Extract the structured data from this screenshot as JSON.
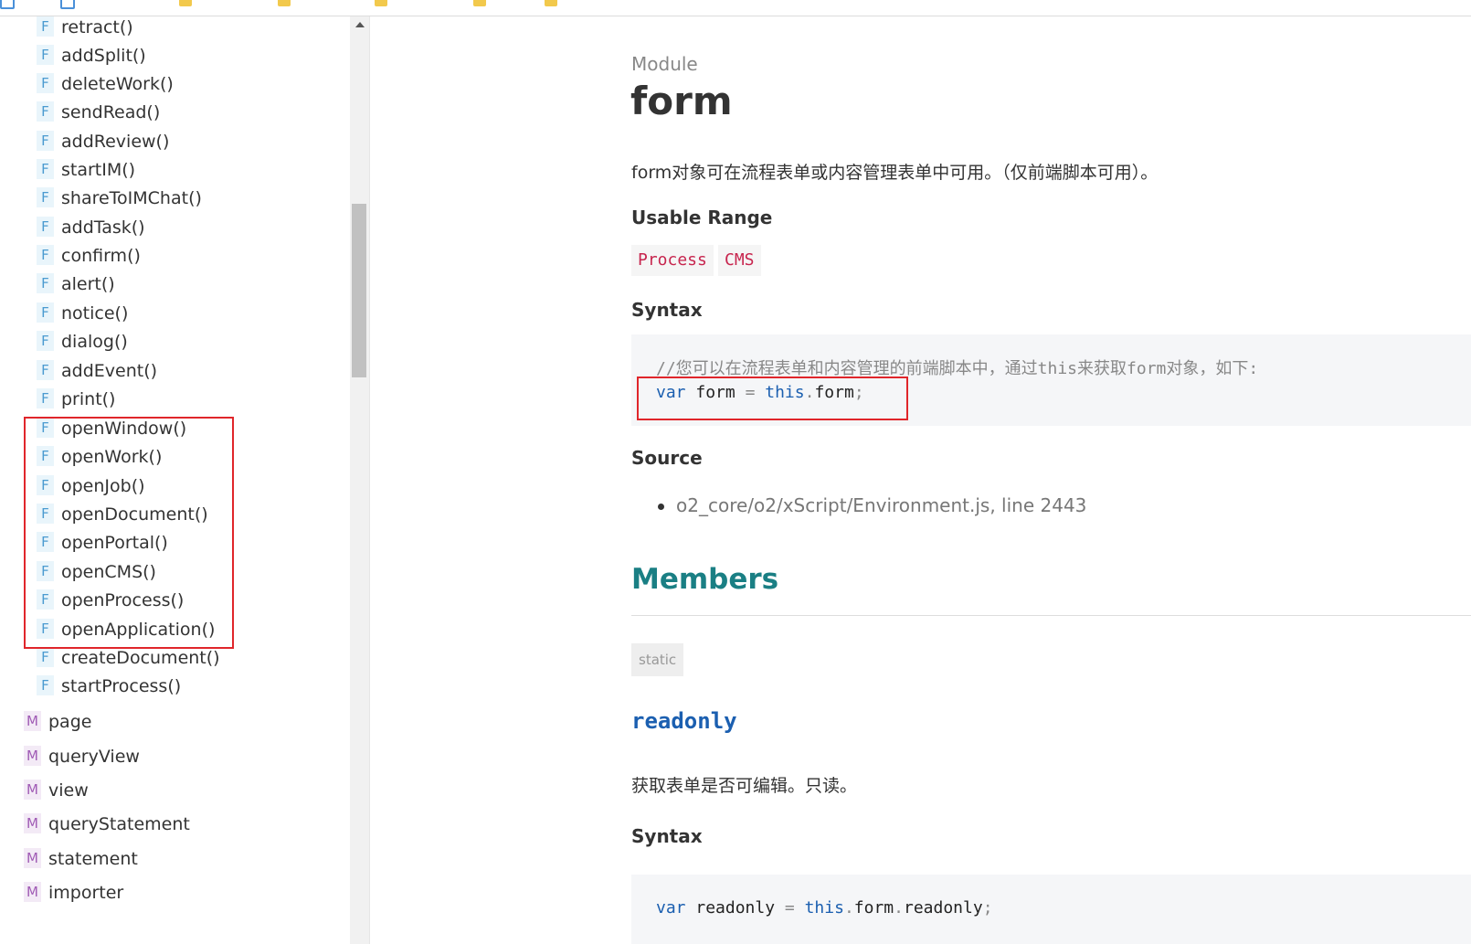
{
  "bookmarks": [
    "",
    "",
    "",
    "",
    "",
    "",
    ""
  ],
  "sidebar": {
    "functions": [
      "retract()",
      "addSplit()",
      "deleteWork()",
      "sendRead()",
      "addReview()",
      "startIM()",
      "shareToIMChat()",
      "addTask()",
      "confirm()",
      "alert()",
      "notice()",
      "dialog()",
      "addEvent()",
      "print()",
      "openWindow()",
      "openWork()",
      "openJob()",
      "openDocument()",
      "openPortal()",
      "openCMS()",
      "openProcess()",
      "openApplication()",
      "createDocument()",
      "startProcess()"
    ],
    "modules": [
      "page",
      "queryView",
      "view",
      "queryStatement",
      "statement",
      "importer"
    ],
    "function_badge": "F",
    "module_badge": "M"
  },
  "main": {
    "kind": "Module",
    "title": "form",
    "description": "form对象可在流程表单或内容管理表单中可用。（仅前端脚本可用）。",
    "usable_range_heading": "Usable Range",
    "usable_range_tags": [
      "Process",
      "CMS"
    ],
    "syntax_heading": "Syntax",
    "syntax_comment": "//您可以在流程表单和内容管理的前端脚本中，通过this来获取form对象，如下:",
    "syntax_code": {
      "kw_var": "var",
      "name": "form",
      "eq": "=",
      "kw_this": "this",
      "dot": ".",
      "prop": "form",
      "semi": ";"
    },
    "source_heading": "Source",
    "source_item": "o2_core/o2/xScript/Environment.js, line 2443",
    "members_heading": "Members",
    "static_tag": "static",
    "member": {
      "name": "readonly",
      "description": "获取表单是否可编辑。只读。",
      "syntax_heading": "Syntax",
      "code": {
        "kw_var": "var",
        "name": "readonly",
        "eq": "=",
        "kw_this": "this",
        "dot1": ".",
        "form": "form",
        "dot2": ".",
        "prop": "readonly",
        "semi": ";"
      }
    }
  },
  "colors": {
    "highlight_box": "#e0262b",
    "members_heading": "#1a7f84",
    "member_name": "#1b5fb0",
    "tag_text": "#c7254e"
  }
}
